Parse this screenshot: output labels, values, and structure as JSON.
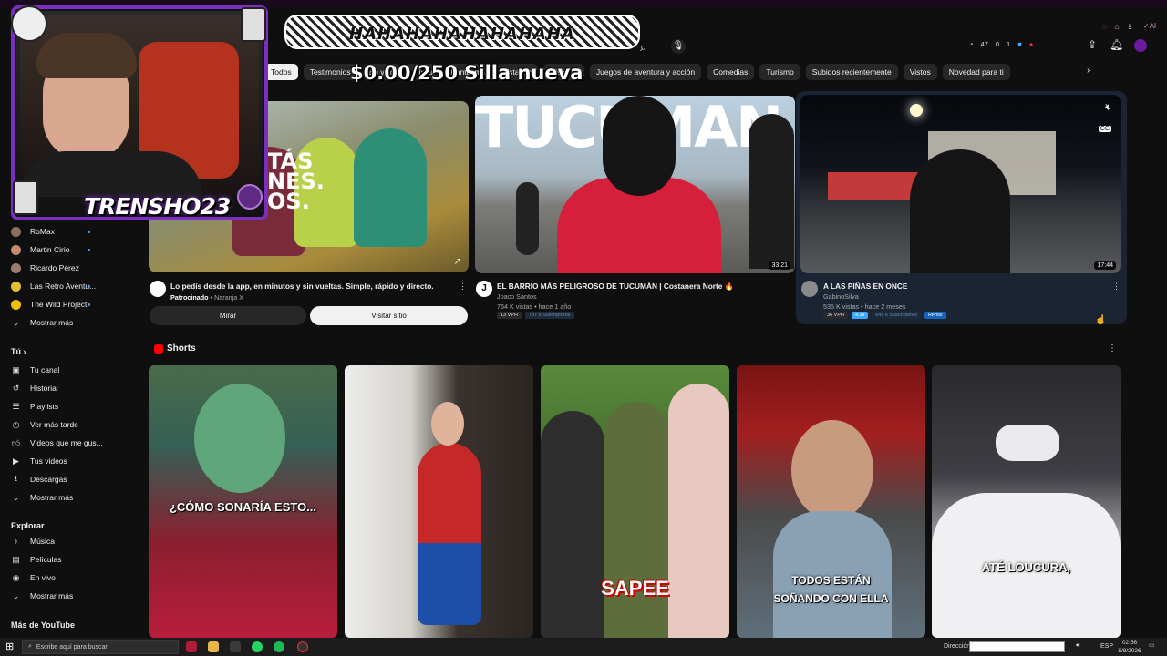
{
  "overlay": {
    "laugh_banner": "HAHAHAHAHAHAHAHA",
    "goal_text": "$0.00/250 Silla nueva",
    "streamer_name": "TRENSHO23"
  },
  "header": {
    "counters": [
      "47",
      "0",
      "1"
    ]
  },
  "chips": [
    "Todos",
    "Testimonios",
    "En vivo",
    "Mixes",
    "Fantasma",
    "Estados",
    "Historial",
    "Juegos de aventura y acción",
    "Comedias",
    "Turismo",
    "Subidos recientemente",
    "Vistos",
    "Novedad para ti"
  ],
  "sidebar": {
    "subscriptions": [
      "RoMax",
      "Martin Cirio",
      "Ricardo Pérez",
      "Las Retro Aventu...",
      "The Wild Project"
    ],
    "subs_more": "Mostrar más",
    "you_title": "Tú",
    "you_items": [
      "Tu canal",
      "Historial",
      "Playlists",
      "Ver más tarde",
      "Videos que me gus...",
      "Tus videos",
      "Descargas",
      "Mostrar más"
    ],
    "explore_title": "Explorar",
    "explore_items": [
      "Música",
      "Películas",
      "En vivo",
      "Mostrar más"
    ],
    "more_title": "Más de YouTube"
  },
  "videos": [
    {
      "title": "Lo pedís desde la app, en minutos y sin vueltas. Simple, rápido y directo.",
      "sponsored": "Patrocinado",
      "advertiser": "Naranja X",
      "thumb_text": "TÁS NES. OS.",
      "btn_watch": "Mirar",
      "btn_visit": "Visitar sitio"
    },
    {
      "title": "EL BARRIO MÁS PELIGROSO DE TUCUMÁN | Costanera Norte 🔥",
      "channel": "Joaco Santos",
      "meta": "764 K vistas • hace 1 año",
      "vph": "13 VPH",
      "subs": "737 k Suscriptores",
      "duration": "33:21",
      "thumb_text": "TUCUMAN"
    },
    {
      "title": "A LAS PIÑAS EN ONCE",
      "channel": "GabinoSilva",
      "meta": "535 K vistas • hace 2 meses",
      "vph": "36 VPH",
      "ratio": "4.1x",
      "subs": "645 k Suscriptores",
      "remix": "Remix",
      "duration": "17:44"
    }
  ],
  "shorts": {
    "title": "Shorts",
    "items": [
      {
        "caption": "¿CÓMO SONARÍA ESTO..."
      },
      {
        "caption": ""
      },
      {
        "caption": "SAPEE"
      },
      {
        "caption": "TODOS ESTÁN SOÑANDO CON ELLA"
      },
      {
        "caption": "ATÉ LOUCURA,"
      }
    ]
  },
  "taskbar": {
    "search_placeholder": "Escribe aquí para buscar.",
    "address_label": "Dirección",
    "lang": "ESP",
    "time": "02:56",
    "date": "8/8/2026"
  },
  "colors": {
    "background": "#0f0f0f",
    "accent_red": "#ff0000",
    "link_blue": "#3ea6ff",
    "overlay_purple": "#8a2be2"
  }
}
